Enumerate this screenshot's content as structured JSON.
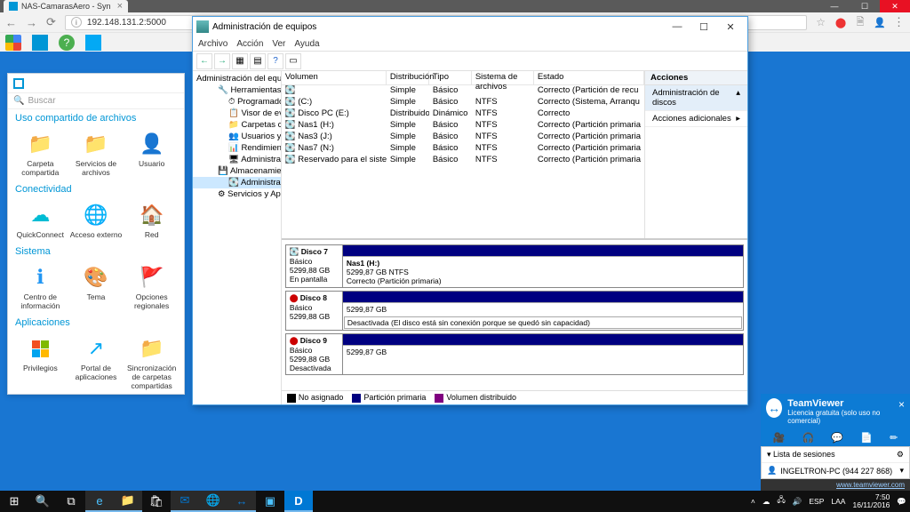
{
  "browser": {
    "tab_title": "NAS-CamarasAero - Syn",
    "url": "192.148.131.2:5000"
  },
  "synology": {
    "search_placeholder": "Buscar",
    "sections": {
      "share": "Uso compartido de archivos",
      "conn": "Conectividad",
      "sys": "Sistema",
      "apps": "Aplicaciones"
    },
    "share_items": [
      "Carpeta compartida",
      "Servicios de archivos",
      "Usuario"
    ],
    "conn_items": [
      "QuickConnect",
      "Acceso externo",
      "Red"
    ],
    "sys_items": [
      "Centro de información",
      "Tema",
      "Opciones regionales"
    ],
    "app_items": [
      "Privilegios",
      "Portal de aplicaciones",
      "Sincronización de carpetas compartidas"
    ]
  },
  "diskmgmt": {
    "title": "Administración de equipos",
    "menu": [
      "Archivo",
      "Acción",
      "Ver",
      "Ayuda"
    ],
    "tree": {
      "root": "Administración del equipo (loc",
      "herr": "Herramientas del sistema",
      "prog": "Programador de tareas",
      "visor": "Visor de eventos",
      "carp": "Carpetas compartidas",
      "usr": "Usuarios y grupos locale",
      "rend": "Rendimiento",
      "admdisp": "Administrador de dispo",
      "alm": "Almacenamiento",
      "admdisc": "Administración de disco",
      "serv": "Servicios y Aplicaciones"
    },
    "vol_headers": [
      "Volumen",
      "Distribución",
      "Tipo",
      "Sistema de archivos",
      "Estado"
    ],
    "volumes": [
      {
        "v": "",
        "d": "Simple",
        "t": "Básico",
        "fs": "",
        "e": "Correcto (Partición de recu"
      },
      {
        "v": "(C:)",
        "d": "Simple",
        "t": "Básico",
        "fs": "NTFS",
        "e": "Correcto (Sistema, Arranqu"
      },
      {
        "v": "Disco PC (E:)",
        "d": "Distribuido",
        "t": "Dinámico",
        "fs": "NTFS",
        "e": "Correcto"
      },
      {
        "v": "Nas1 (H:)",
        "d": "Simple",
        "t": "Básico",
        "fs": "NTFS",
        "e": "Correcto (Partición primaria"
      },
      {
        "v": "Nas3 (J:)",
        "d": "Simple",
        "t": "Básico",
        "fs": "NTFS",
        "e": "Correcto (Partición primaria"
      },
      {
        "v": "Nas7 (N:)",
        "d": "Simple",
        "t": "Básico",
        "fs": "NTFS",
        "e": "Correcto (Partición primaria"
      },
      {
        "v": "Reservado para el sistema (G:)",
        "d": "Simple",
        "t": "Básico",
        "fs": "NTFS",
        "e": "Correcto (Partición primaria"
      }
    ],
    "actions_h": "Acciones",
    "actions": [
      "Administración de discos",
      "Acciones adicionales"
    ],
    "disks": [
      {
        "name": "Disco 7",
        "type": "Básico",
        "size": "5299,88 GB",
        "status": "En pantalla",
        "part": "Nas1  (H:)",
        "psize": "5299,87 GB NTFS",
        "pstat": "Correcto (Partición primaria)"
      },
      {
        "name": "Disco 8",
        "type": "Básico",
        "size": "5299,88 GB",
        "status": "Desactivada",
        "psize": "5299,87 GB",
        "offmsg": "El disco está sin conexión porque se quedó sin capacidad"
      },
      {
        "name": "Disco 9",
        "type": "Básico",
        "size": "5299,88 GB",
        "status": "Desactivada",
        "psize": "5299,87 GB"
      }
    ],
    "legend": [
      "No asignado",
      "Partición primaria",
      "Volumen distribuido"
    ]
  },
  "teamviewer": {
    "title": "TeamViewer",
    "sub": "Licencia gratuita (solo uso no comercial)",
    "sess_h": "Lista de sesiones",
    "sess": "INGELTRON-PC (944 227 868)",
    "foot": "www.teamviewer.com"
  },
  "tray": {
    "lang": "ESP",
    "kb": "LAA",
    "time": "7:50",
    "date": "16/11/2016"
  }
}
